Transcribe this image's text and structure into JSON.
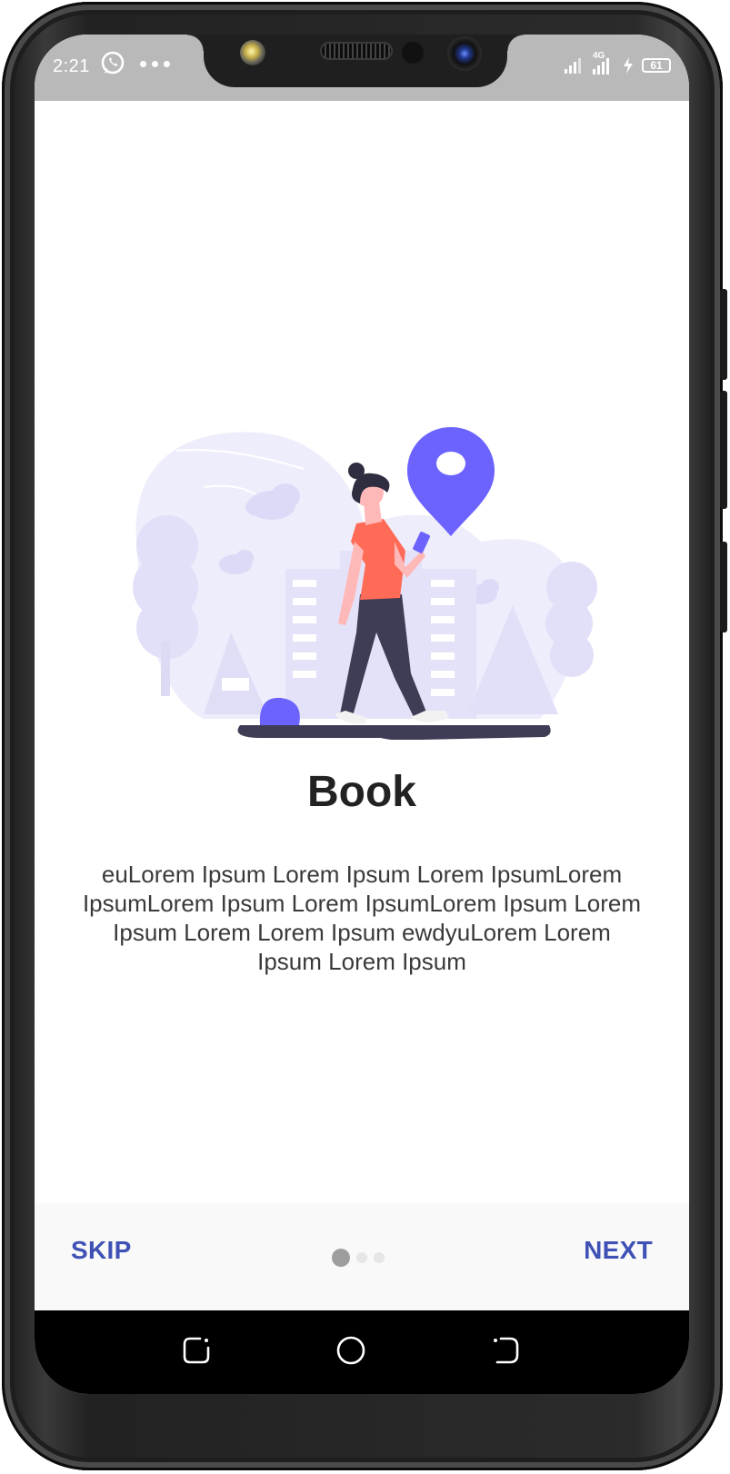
{
  "status_bar": {
    "time": "2:21",
    "network_label": "4G",
    "battery_level": "61",
    "icons": [
      "whatsapp-icon",
      "more-dots-icon",
      "signal-icon",
      "network-4g-icon",
      "charging-icon",
      "battery-icon"
    ]
  },
  "onboarding": {
    "title": "Book",
    "description": "euLorem Ipsum Lorem Ipsum Lorem IpsumLorem IpsumLorem Ipsum Lorem IpsumLorem Ipsum Lorem Ipsum Lorem Lorem Ipsum ewdyuLorem Lorem Ipsum Lorem Ipsum",
    "illustration": "woman-walking-with-phone-location-pin",
    "illustration_colors": {
      "primary": "#6c63ff",
      "background_shape": "#eeedfb",
      "shirt": "#ff6b57",
      "pants": "#3f3d56"
    }
  },
  "bottom_bar": {
    "skip_label": "SKIP",
    "next_label": "NEXT",
    "page_indicator": {
      "current": 1,
      "total": 3
    },
    "accent_color": "#3f51b5"
  },
  "navigation_bar": {
    "buttons": [
      "recent-apps-icon",
      "home-icon",
      "back-icon"
    ]
  }
}
